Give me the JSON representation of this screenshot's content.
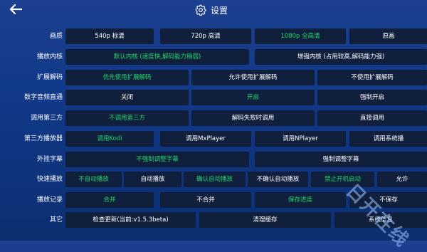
{
  "header": {
    "title": "设置"
  },
  "rows": [
    {
      "label": "画质",
      "options": [
        "540p 标清",
        "720p 高清",
        "1080p 全高清",
        "原画"
      ],
      "selected": 2
    },
    {
      "label": "播放内核",
      "options": [
        "默认内核 (速度快,解码能力稍弱)",
        "增强内核 (占用较高,解码能力强)"
      ],
      "selected": 0
    },
    {
      "label": "扩展解码",
      "options": [
        "优先使用扩展解码",
        "允许使用扩展解码",
        "不使用扩展解码"
      ],
      "selected": 0
    },
    {
      "label": "数字音频直通",
      "options": [
        "关闭",
        "开启",
        "强制开启"
      ],
      "selected": 1
    },
    {
      "label": "调用第三方",
      "options": [
        "不调用第三方",
        "解码失败时调用",
        "直接调用"
      ],
      "selected": 0
    },
    {
      "label": "第三方播放器",
      "options": [
        "调用Kodi",
        "调用MxPlayer",
        "调用NPlayer",
        "调用系统播"
      ],
      "selected": 0
    },
    {
      "label": "外挂字幕",
      "options": [
        "不强制调整字幕",
        "强制调整字幕"
      ],
      "selected": 0
    },
    {
      "label": "快速播放",
      "options": [
        "不自动播放",
        "自动播放",
        "确认自动播放",
        "不确认自动播放",
        "禁止开机启动",
        "允许"
      ],
      "selected": 0,
      "selected_extra": [
        2,
        4
      ]
    },
    {
      "label": "播放记录",
      "options": [
        "合并",
        "不合并",
        "保存进度",
        "不保存"
      ],
      "selected": 0,
      "selected_extra": [
        2
      ]
    },
    {
      "label": "其它",
      "options": [
        "检查更新(当前:v1.5.3beta)",
        "清理缓存",
        "系统信息"
      ],
      "selected": -1
    }
  ],
  "colors": {
    "selected": "#22d76a",
    "button_bg": "#0f1f3c",
    "background": "#143a86"
  },
  "icons": {
    "back": "arrow-left-icon",
    "title": "gear-icon"
  },
  "watermark": "日开在线"
}
